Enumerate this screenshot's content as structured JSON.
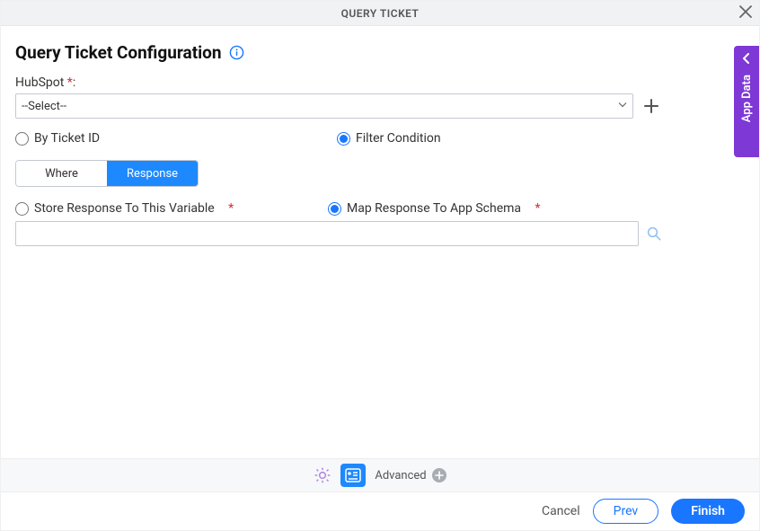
{
  "titlebar": {
    "title": "QUERY TICKET"
  },
  "header": {
    "title": "Query Ticket Configuration"
  },
  "hubspot": {
    "label": "HubSpot",
    "asterisk": "*",
    "colon": ":",
    "selected": "--Select--"
  },
  "mode": {
    "by_id_label": "By Ticket ID",
    "filter_label": "Filter Condition"
  },
  "tabs": {
    "where": "Where",
    "response": "Response"
  },
  "store": {
    "var_label": "Store Response To This Variable",
    "map_label": "Map Response To App Schema",
    "asterisk": "*",
    "value": ""
  },
  "advanced": {
    "label": "Advanced"
  },
  "footer": {
    "cancel": "Cancel",
    "prev": "Prev",
    "finish": "Finish"
  },
  "side": {
    "label": "App Data"
  }
}
